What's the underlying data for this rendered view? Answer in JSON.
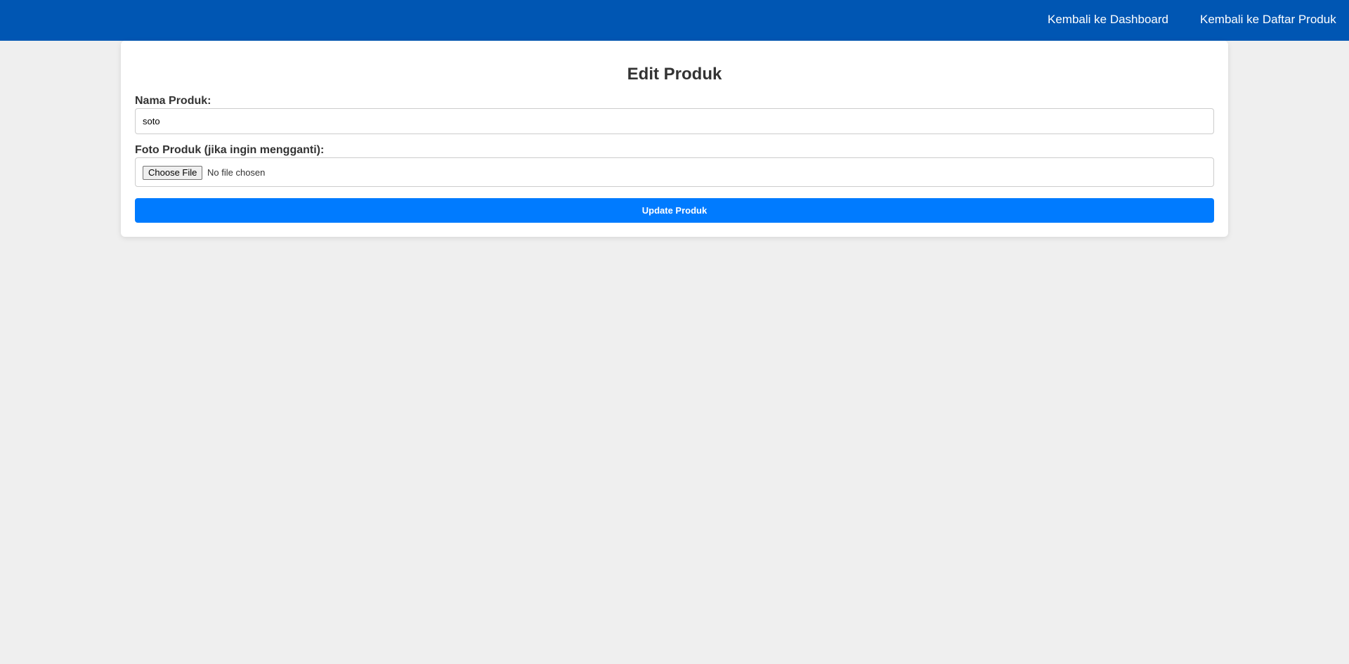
{
  "nav": {
    "dashboard_link": "Kembali ke Dashboard",
    "product_list_link": "Kembali ke Daftar Produk"
  },
  "form": {
    "title": "Edit Produk",
    "name_label": "Nama Produk:",
    "name_value": "soto",
    "photo_label": "Foto Produk (jika ingin mengganti):",
    "file_button_label": "Choose File",
    "file_status": "No file chosen",
    "submit_label": "Update Produk"
  },
  "colors": {
    "nav_background": "#0056b3",
    "primary_button": "#007bff",
    "page_background": "#efefef"
  }
}
